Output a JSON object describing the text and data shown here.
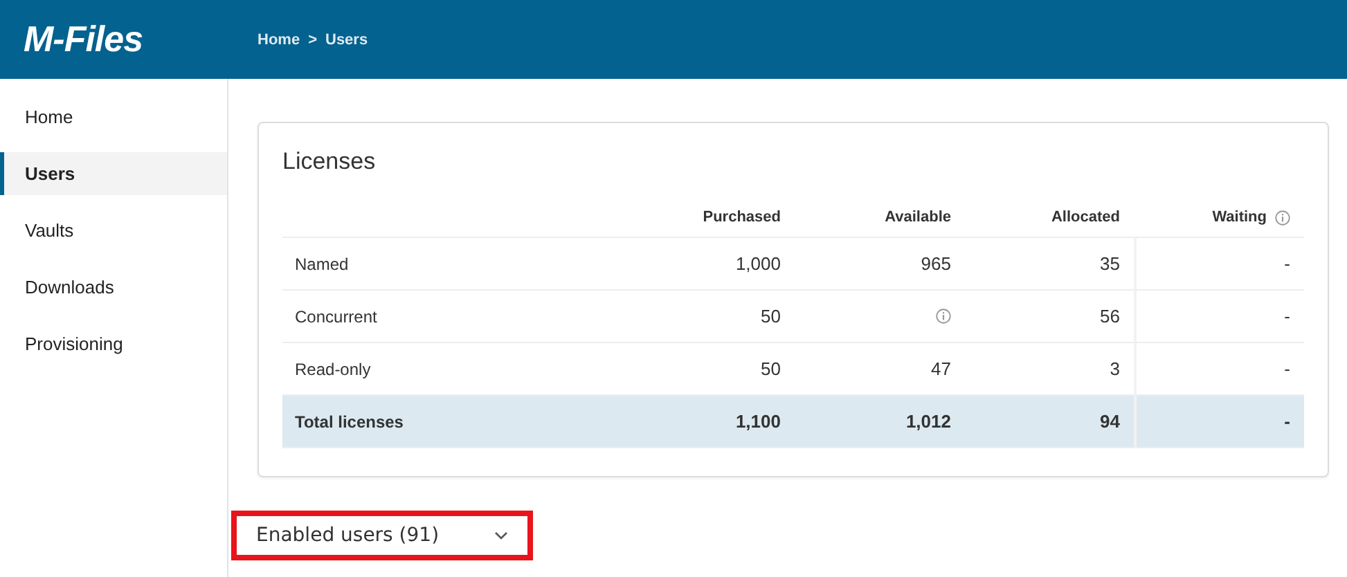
{
  "header": {
    "logo": "M-Files",
    "breadcrumb": [
      {
        "label": "Home"
      },
      {
        "label": "Users"
      }
    ],
    "separator": ">"
  },
  "sidebar": {
    "items": [
      {
        "label": "Home",
        "selected": false
      },
      {
        "label": "Users",
        "selected": true
      },
      {
        "label": "Vaults",
        "selected": false
      },
      {
        "label": "Downloads",
        "selected": false
      },
      {
        "label": "Provisioning",
        "selected": false
      }
    ]
  },
  "licenses": {
    "title": "Licenses",
    "columns": [
      {
        "label": "Purchased",
        "info": false
      },
      {
        "label": "Available",
        "info": false
      },
      {
        "label": "Allocated",
        "info": false
      },
      {
        "label": "Waiting",
        "info": true
      }
    ],
    "rows": [
      {
        "label": "Named",
        "total": false,
        "cells": [
          {
            "kind": "text",
            "text": "1,000"
          },
          {
            "kind": "text",
            "text": "965"
          },
          {
            "kind": "text",
            "text": "35"
          },
          {
            "kind": "text",
            "text": "-"
          }
        ]
      },
      {
        "label": "Concurrent",
        "total": false,
        "cells": [
          {
            "kind": "text",
            "text": "50"
          },
          {
            "kind": "info"
          },
          {
            "kind": "text",
            "text": "56"
          },
          {
            "kind": "text",
            "text": "-"
          }
        ]
      },
      {
        "label": "Read-only",
        "total": false,
        "cells": [
          {
            "kind": "text",
            "text": "50"
          },
          {
            "kind": "text",
            "text": "47"
          },
          {
            "kind": "text",
            "text": "3"
          },
          {
            "kind": "text",
            "text": "-"
          }
        ]
      },
      {
        "label": "Total licenses",
        "total": true,
        "cells": [
          {
            "kind": "text",
            "text": "1,100"
          },
          {
            "kind": "text",
            "text": "1,012"
          },
          {
            "kind": "text",
            "text": "94"
          },
          {
            "kind": "text",
            "text": "-"
          }
        ]
      }
    ]
  },
  "users_dropdown": {
    "label": "Enabled users (91)",
    "highlighted": true
  }
}
